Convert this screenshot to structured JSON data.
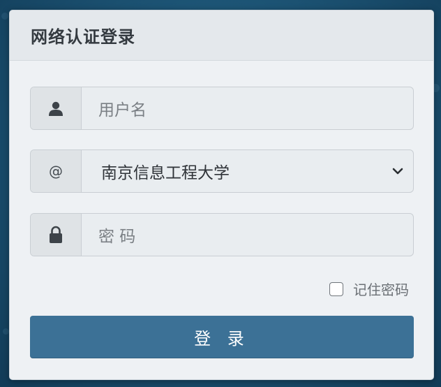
{
  "panel": {
    "title": "网络认证登录"
  },
  "form": {
    "username_placeholder": "用户名",
    "domain_addon": "@",
    "domain_selected": "南京信息工程大学",
    "password_placeholder": "密 码",
    "remember_label": "记住密码",
    "remember_checked": false,
    "login_label": "登 录"
  },
  "icons": {
    "username": "user-icon",
    "password": "lock-icon",
    "dropdown": "chevron-down-icon"
  },
  "colors": {
    "primary_button": "#3c7196",
    "panel_bg": "#eef1f4"
  }
}
